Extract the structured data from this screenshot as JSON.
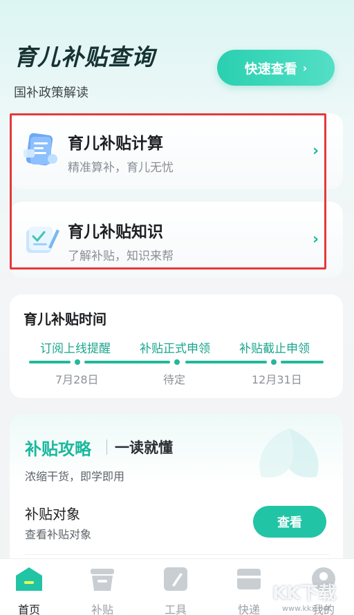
{
  "header": {
    "title": "育儿补贴查询",
    "subtitle": "国补政策解读",
    "quick_button": "快速查看",
    "quick_chevron": "›"
  },
  "menu": [
    {
      "title": "育儿补贴计算",
      "subtitle": "精准算补，育儿无忧",
      "chevron": "›"
    },
    {
      "title": "育儿补贴知识",
      "subtitle": "了解补贴，知识来帮",
      "chevron": "›"
    }
  ],
  "timeline": {
    "title": "育儿补贴时间",
    "stages": [
      {
        "label": "订阅上线提醒",
        "date": "7月28日"
      },
      {
        "label": "补贴正式申领",
        "date": "待定"
      },
      {
        "label": "补贴截止申领",
        "date": "12月31日"
      }
    ]
  },
  "guide": {
    "title": "补贴攻略",
    "tag": "一读就懂",
    "subtitle": "浓缩干货，即学即用",
    "item_title": "补贴对象",
    "item_sub": "查看补贴对象",
    "view_button": "查看"
  },
  "tabs": [
    {
      "label": "首页",
      "icon": "home-icon",
      "active": true
    },
    {
      "label": "补贴",
      "icon": "basket-icon",
      "active": false
    },
    {
      "label": "工具",
      "icon": "pen-icon",
      "active": false
    },
    {
      "label": "快递",
      "icon": "box-icon",
      "active": false
    },
    {
      "label": "我的",
      "icon": "user-icon",
      "active": false
    }
  ],
  "watermark": {
    "text": "KK下载",
    "url": "www.kkx.net"
  },
  "colors": {
    "accent": "#22c4a6",
    "highlight_border": "#e6383a"
  }
}
